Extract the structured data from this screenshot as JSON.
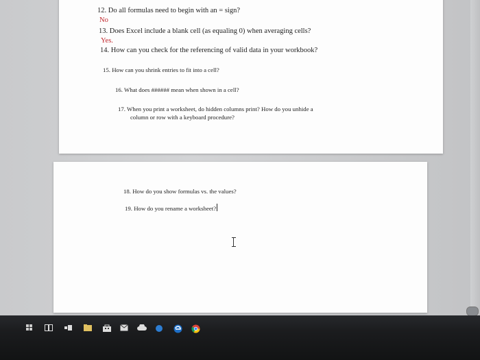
{
  "document": {
    "page1": {
      "q12": "12. Do all formulas need to begin with an = sign?",
      "a12": "No",
      "q13": "13. Does Excel include a blank cell (as equaling 0) when averaging cells?",
      "a13": "Yes.",
      "q14": "14. How can you check for the referencing of valid data in your workbook?",
      "q15": "15. How can you shrink entries to fit into a cell?",
      "q16": "16. What does ###### mean when shown in a cell?",
      "q17_line1": "17. When you print a worksheet, do hidden columns print? How do you unhide a",
      "q17_line2": "column or row with a keyboard procedure?"
    },
    "page2": {
      "q18": "18. How do you show formulas vs. the values?",
      "q19": "19. How do you rename a worksheet?"
    }
  },
  "taskbar": {
    "icons": [
      "start-icon",
      "task-view-icon",
      "app-icon",
      "file-explorer-icon",
      "store-icon",
      "mail-icon",
      "cloud-icon",
      "edge-icon",
      "chrome-icon"
    ]
  },
  "colors": {
    "answer_text": "#c0262c",
    "body_text": "#1d1d1d",
    "page_bg": "#fdfdfd",
    "taskbar_bg": "#1b1c1e"
  }
}
